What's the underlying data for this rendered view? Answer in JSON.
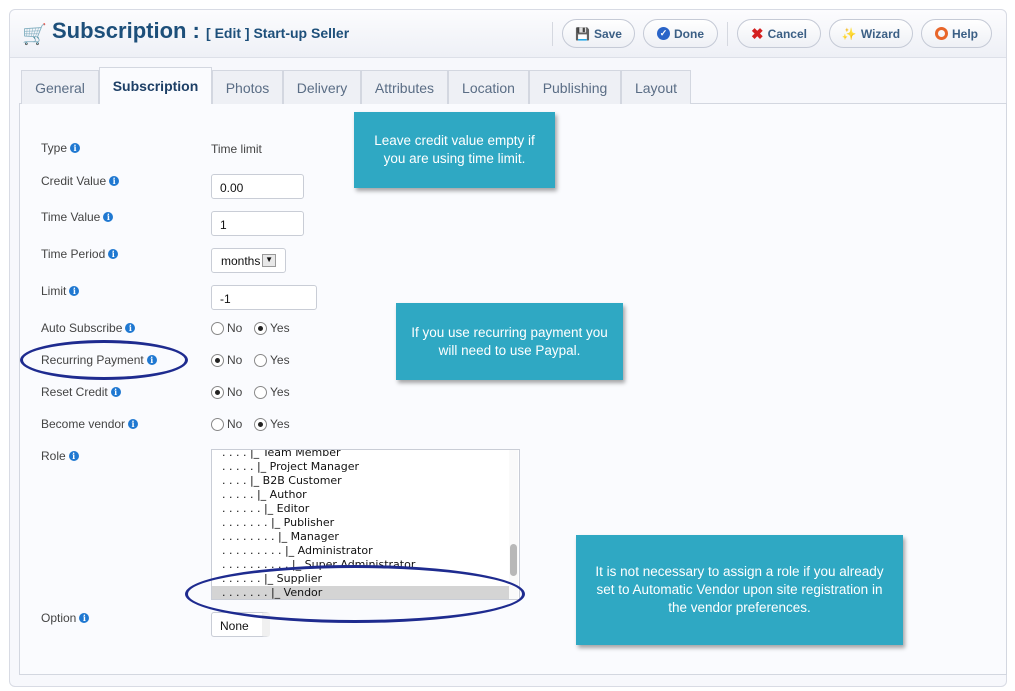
{
  "header": {
    "title": "Subscription :",
    "subtitle": "[ Edit ] Start-up Seller"
  },
  "toolbar": {
    "save": "Save",
    "done": "Done",
    "cancel": "Cancel",
    "wizard": "Wizard",
    "help": "Help"
  },
  "tabs": [
    "General",
    "Subscription",
    "Photos",
    "Delivery",
    "Attributes",
    "Location",
    "Publishing",
    "Layout"
  ],
  "active_tab": "Subscription",
  "form": {
    "type_label": "Type",
    "type_value": "Time limit",
    "credit_label": "Credit Value",
    "credit_value": "0.00",
    "time_value_label": "Time Value",
    "time_value": "1",
    "time_period_label": "Time Period",
    "time_period": "months",
    "limit_label": "Limit",
    "limit_value": "-1",
    "auto_subscribe_label": "Auto Subscribe",
    "recurring_label": "Recurring Payment",
    "reset_credit_label": "Reset Credit",
    "become_vendor_label": "Become vendor",
    "no": "No",
    "yes": "Yes",
    "auto_subscribe": "Yes",
    "recurring": "No",
    "reset_credit": "No",
    "become_vendor": "Yes",
    "role_label": "Role",
    "roles": [
      ". . . . |_ Team Member",
      ". . . . . |_ Project Manager",
      ". . . . |_ B2B Customer",
      ". . . . . |_ Author",
      ". . . . . . |_ Editor",
      ". . . . . . . |_ Publisher",
      ". . . . . . . . |_ Manager",
      ". . . . . . . . . |_ Administrator",
      ". . . . . . . . . . |_ Super Administrator",
      ". . . . . . |_ Supplier",
      ". . . . . . . |_ Vendor"
    ],
    "selected_role": "Vendor",
    "option_label": "Option",
    "option_value": "None"
  },
  "tooltips": {
    "credit": "Leave credit value empty if you are using time limit.",
    "recurring": "If you use recurring payment you will need to use Paypal.",
    "role": "It is not necessary to assign a role if you already set to Automatic Vendor upon site registration in the vendor preferences."
  },
  "colors": {
    "title": "#1d4f7a",
    "tooltip": "#2fa8c3",
    "highlight_ellipse": "#1e2b8f"
  }
}
